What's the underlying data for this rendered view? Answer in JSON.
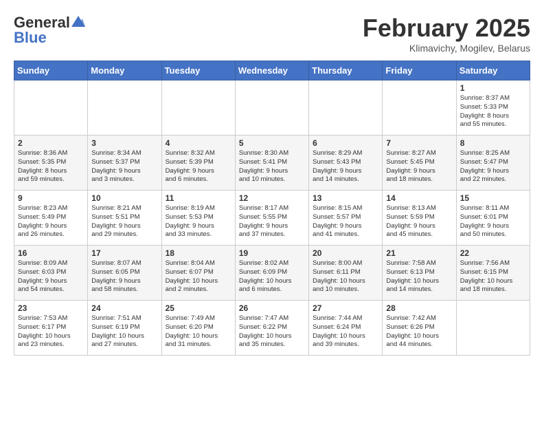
{
  "header": {
    "logo_general": "General",
    "logo_blue": "Blue",
    "month_year": "February 2025",
    "location": "Klimavichy, Mogilev, Belarus"
  },
  "weekdays": [
    "Sunday",
    "Monday",
    "Tuesday",
    "Wednesday",
    "Thursday",
    "Friday",
    "Saturday"
  ],
  "weeks": [
    [
      {
        "day": "",
        "info": ""
      },
      {
        "day": "",
        "info": ""
      },
      {
        "day": "",
        "info": ""
      },
      {
        "day": "",
        "info": ""
      },
      {
        "day": "",
        "info": ""
      },
      {
        "day": "",
        "info": ""
      },
      {
        "day": "1",
        "info": "Sunrise: 8:37 AM\nSunset: 5:33 PM\nDaylight: 8 hours\nand 55 minutes."
      }
    ],
    [
      {
        "day": "2",
        "info": "Sunrise: 8:36 AM\nSunset: 5:35 PM\nDaylight: 8 hours\nand 59 minutes."
      },
      {
        "day": "3",
        "info": "Sunrise: 8:34 AM\nSunset: 5:37 PM\nDaylight: 9 hours\nand 3 minutes."
      },
      {
        "day": "4",
        "info": "Sunrise: 8:32 AM\nSunset: 5:39 PM\nDaylight: 9 hours\nand 6 minutes."
      },
      {
        "day": "5",
        "info": "Sunrise: 8:30 AM\nSunset: 5:41 PM\nDaylight: 9 hours\nand 10 minutes."
      },
      {
        "day": "6",
        "info": "Sunrise: 8:29 AM\nSunset: 5:43 PM\nDaylight: 9 hours\nand 14 minutes."
      },
      {
        "day": "7",
        "info": "Sunrise: 8:27 AM\nSunset: 5:45 PM\nDaylight: 9 hours\nand 18 minutes."
      },
      {
        "day": "8",
        "info": "Sunrise: 8:25 AM\nSunset: 5:47 PM\nDaylight: 9 hours\nand 22 minutes."
      }
    ],
    [
      {
        "day": "9",
        "info": "Sunrise: 8:23 AM\nSunset: 5:49 PM\nDaylight: 9 hours\nand 26 minutes."
      },
      {
        "day": "10",
        "info": "Sunrise: 8:21 AM\nSunset: 5:51 PM\nDaylight: 9 hours\nand 29 minutes."
      },
      {
        "day": "11",
        "info": "Sunrise: 8:19 AM\nSunset: 5:53 PM\nDaylight: 9 hours\nand 33 minutes."
      },
      {
        "day": "12",
        "info": "Sunrise: 8:17 AM\nSunset: 5:55 PM\nDaylight: 9 hours\nand 37 minutes."
      },
      {
        "day": "13",
        "info": "Sunrise: 8:15 AM\nSunset: 5:57 PM\nDaylight: 9 hours\nand 41 minutes."
      },
      {
        "day": "14",
        "info": "Sunrise: 8:13 AM\nSunset: 5:59 PM\nDaylight: 9 hours\nand 45 minutes."
      },
      {
        "day": "15",
        "info": "Sunrise: 8:11 AM\nSunset: 6:01 PM\nDaylight: 9 hours\nand 50 minutes."
      }
    ],
    [
      {
        "day": "16",
        "info": "Sunrise: 8:09 AM\nSunset: 6:03 PM\nDaylight: 9 hours\nand 54 minutes."
      },
      {
        "day": "17",
        "info": "Sunrise: 8:07 AM\nSunset: 6:05 PM\nDaylight: 9 hours\nand 58 minutes."
      },
      {
        "day": "18",
        "info": "Sunrise: 8:04 AM\nSunset: 6:07 PM\nDaylight: 10 hours\nand 2 minutes."
      },
      {
        "day": "19",
        "info": "Sunrise: 8:02 AM\nSunset: 6:09 PM\nDaylight: 10 hours\nand 6 minutes."
      },
      {
        "day": "20",
        "info": "Sunrise: 8:00 AM\nSunset: 6:11 PM\nDaylight: 10 hours\nand 10 minutes."
      },
      {
        "day": "21",
        "info": "Sunrise: 7:58 AM\nSunset: 6:13 PM\nDaylight: 10 hours\nand 14 minutes."
      },
      {
        "day": "22",
        "info": "Sunrise: 7:56 AM\nSunset: 6:15 PM\nDaylight: 10 hours\nand 18 minutes."
      }
    ],
    [
      {
        "day": "23",
        "info": "Sunrise: 7:53 AM\nSunset: 6:17 PM\nDaylight: 10 hours\nand 23 minutes."
      },
      {
        "day": "24",
        "info": "Sunrise: 7:51 AM\nSunset: 6:19 PM\nDaylight: 10 hours\nand 27 minutes."
      },
      {
        "day": "25",
        "info": "Sunrise: 7:49 AM\nSunset: 6:20 PM\nDaylight: 10 hours\nand 31 minutes."
      },
      {
        "day": "26",
        "info": "Sunrise: 7:47 AM\nSunset: 6:22 PM\nDaylight: 10 hours\nand 35 minutes."
      },
      {
        "day": "27",
        "info": "Sunrise: 7:44 AM\nSunset: 6:24 PM\nDaylight: 10 hours\nand 39 minutes."
      },
      {
        "day": "28",
        "info": "Sunrise: 7:42 AM\nSunset: 6:26 PM\nDaylight: 10 hours\nand 44 minutes."
      },
      {
        "day": "",
        "info": ""
      }
    ]
  ]
}
